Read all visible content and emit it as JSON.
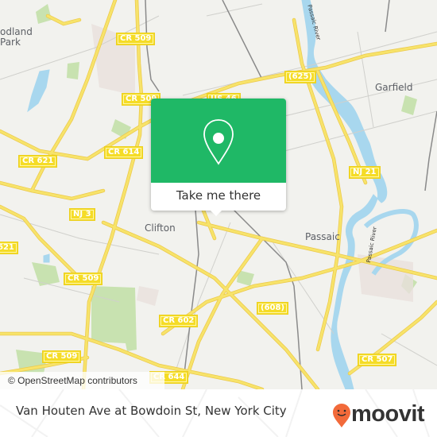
{
  "map": {
    "attribution": "© OpenStreetMap contributors",
    "colors": {
      "background": "#f2f2ee",
      "road": "#f7e36a",
      "water": "#a8d7ee",
      "park": "#c8e2b0",
      "accent": "#1fb866",
      "brand": "#f26a3a"
    },
    "place_labels": [
      {
        "id": "woodland-park",
        "text": "odland\nPark"
      },
      {
        "id": "clifton",
        "text": "Clifton"
      },
      {
        "id": "passaic",
        "text": "Passaic"
      },
      {
        "id": "garfield",
        "text": "Garfield"
      }
    ],
    "water_labels": [
      {
        "id": "passaic-river-north",
        "text": "Passaic River"
      },
      {
        "id": "passaic-river-south",
        "text": "Passaic River"
      }
    ],
    "road_shields": [
      {
        "id": "cr509-top",
        "text": "CR 509"
      },
      {
        "id": "cr509-mid",
        "text": "CR 509"
      },
      {
        "id": "us46",
        "text": "US 46"
      },
      {
        "id": "cr614",
        "text": "CR 614"
      },
      {
        "id": "cr621",
        "text": "CR 621"
      },
      {
        "id": "nj3",
        "text": "NJ 3"
      },
      {
        "id": "cr621-left",
        "text": "621"
      },
      {
        "id": "cr509-lower",
        "text": "CR 509"
      },
      {
        "id": "cr509-bottom",
        "text": "CR 509"
      },
      {
        "id": "cr602",
        "text": "CR 602"
      },
      {
        "id": "cr644",
        "text": "CR 644"
      },
      {
        "id": "r625",
        "text": "(625)"
      },
      {
        "id": "nj21",
        "text": "NJ 21"
      },
      {
        "id": "r608",
        "text": "(608)"
      },
      {
        "id": "cr507",
        "text": "CR 507"
      }
    ]
  },
  "popup": {
    "icon": "map-pin-icon",
    "label": "Take me there"
  },
  "footer": {
    "title": "Van Houten Ave at Bowdoin St, New York City",
    "brand": "moovit",
    "brand_icon": "moovit-pin-icon"
  }
}
